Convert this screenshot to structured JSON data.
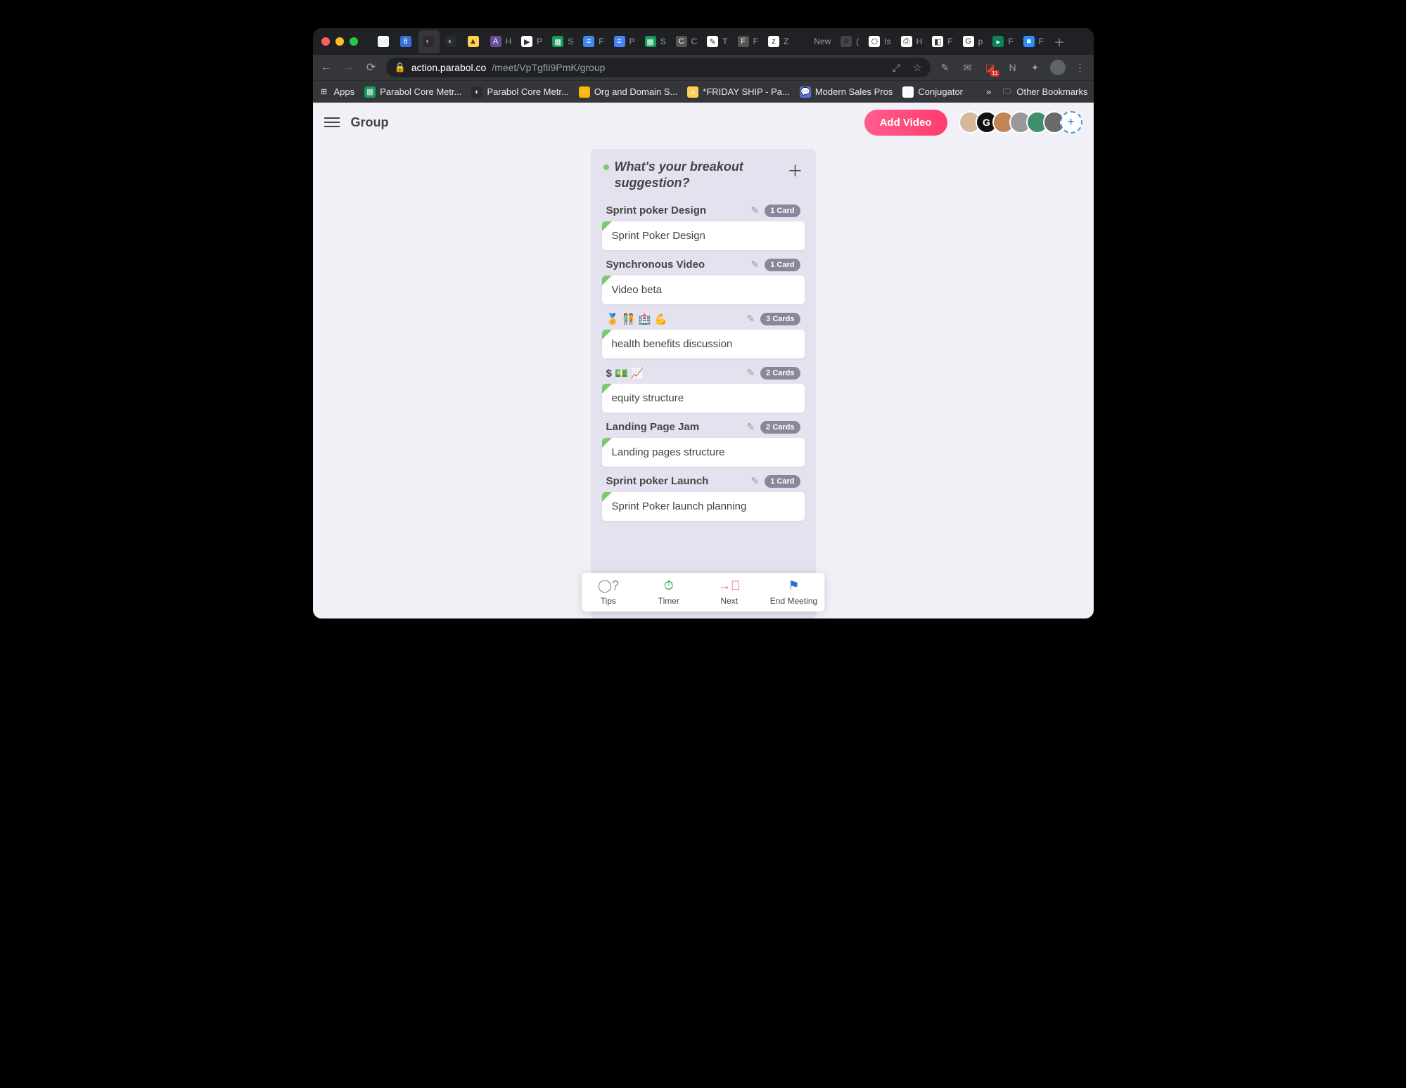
{
  "browser": {
    "url_domain": "action.parabol.co",
    "url_path": "/meet/VpTgfIi9PmK/group",
    "tabs": [
      {
        "icon": "✉️",
        "bg": "#fff",
        "label": ""
      },
      {
        "icon": "8",
        "bg": "#3b6fd6",
        "color": "#fff",
        "label": ""
      },
      {
        "icon": "◐",
        "bg": "#2b2b2b",
        "color": "#ff6aa2",
        "label": "",
        "active": true
      },
      {
        "icon": "◐",
        "bg": "#2b2b2b",
        "color": "#8ecae6",
        "label": ""
      },
      {
        "icon": "▲",
        "bg": "#ffd24c",
        "label": ""
      },
      {
        "icon": "A",
        "bg": "#6a4c93",
        "color": "#fff",
        "label": "H"
      },
      {
        "icon": "▶",
        "bg": "#fff",
        "label": "P"
      },
      {
        "icon": "▦",
        "bg": "#0f9d58",
        "color": "#fff",
        "label": "S"
      },
      {
        "icon": "≡",
        "bg": "#4285f4",
        "color": "#fff",
        "label": "F"
      },
      {
        "icon": "≡",
        "bg": "#4285f4",
        "color": "#fff",
        "label": "P"
      },
      {
        "icon": "▦",
        "bg": "#0f9d58",
        "color": "#fff",
        "label": "S"
      },
      {
        "icon": "C",
        "bg": "#555",
        "color": "#fff",
        "label": "C"
      },
      {
        "icon": "✎",
        "bg": "#fff",
        "label": "T"
      },
      {
        "icon": "F",
        "bg": "#555",
        "color": "#fff",
        "label": "F"
      },
      {
        "icon": "z",
        "bg": "#fff",
        "label": "Z"
      },
      {
        "icon": "",
        "bg": "",
        "label": "New"
      },
      {
        "icon": "☻",
        "bg": "#444",
        "label": "("
      },
      {
        "icon": "⎔",
        "bg": "#fff",
        "label": "Is"
      },
      {
        "icon": "⎙",
        "bg": "#fff",
        "label": "H"
      },
      {
        "icon": "◧",
        "bg": "#fff",
        "label": "F"
      },
      {
        "icon": "G",
        "bg": "#fff",
        "label": "p"
      },
      {
        "icon": "▸",
        "bg": "#0b8457",
        "color": "#fff",
        "label": "F"
      },
      {
        "icon": "■",
        "bg": "#2d8cff",
        "color": "#fff",
        "label": "F"
      }
    ],
    "toolbar_badge": "11",
    "bookmarks": [
      {
        "icon": "⊞",
        "bg": "",
        "label": "Apps"
      },
      {
        "icon": "▦",
        "bg": "#0f9d58",
        "label": "Parabol Core Metr..."
      },
      {
        "icon": "◐",
        "bg": "#2b2b2b",
        "label": "Parabol Core Metr..."
      },
      {
        "icon": "☺",
        "bg": "#ffb400",
        "label": "Org and Domain S..."
      },
      {
        "icon": "▲",
        "bg": "#ffd24c",
        "label": "*FRIDAY SHIP - Pa..."
      },
      {
        "icon": "💬",
        "bg": "#5b6ee1",
        "label": "Modern Sales Pros"
      },
      {
        "icon": "C",
        "bg": "#fff",
        "label": "Conjugator"
      }
    ],
    "bookmarks_more": "»",
    "other_bookmarks": "Other Bookmarks"
  },
  "app": {
    "page_title": "Group",
    "add_video_label": "Add Video",
    "avatars": [
      {
        "bg": "#d7b89c"
      },
      {
        "bg": "#111",
        "txt": "G"
      },
      {
        "bg": "#c08457"
      },
      {
        "bg": "#999"
      },
      {
        "bg": "#3f8f6b"
      },
      {
        "bg": "#6a6a6a"
      }
    ],
    "column": {
      "title": "What's your breakout suggestion?",
      "groups": [
        {
          "name": "Sprint poker Design",
          "count": "1 Card",
          "top_card": "Sprint Poker Design",
          "stack": 1
        },
        {
          "name": "Synchronous Video",
          "count": "1 Card",
          "top_card": "Video beta",
          "stack": 1
        },
        {
          "name": "🏅 🧑‍🤝‍🧑 🏥 💪",
          "count": "3 Cards",
          "top_card": "health benefits discussion",
          "stack": 3
        },
        {
          "name": "$ 💵 📈",
          "count": "2 Cards",
          "top_card": "equity structure",
          "stack": 2
        },
        {
          "name": "Landing Page Jam",
          "count": "2 Cards",
          "top_card": "Landing pages structure",
          "stack": 2
        },
        {
          "name": "Sprint poker Launch",
          "count": "1 Card",
          "top_card": "Sprint Poker launch planning",
          "stack": 1
        }
      ]
    },
    "bottom_bar": {
      "tips": "Tips",
      "timer": "Timer",
      "next": "Next",
      "end": "End Meeting"
    }
  }
}
